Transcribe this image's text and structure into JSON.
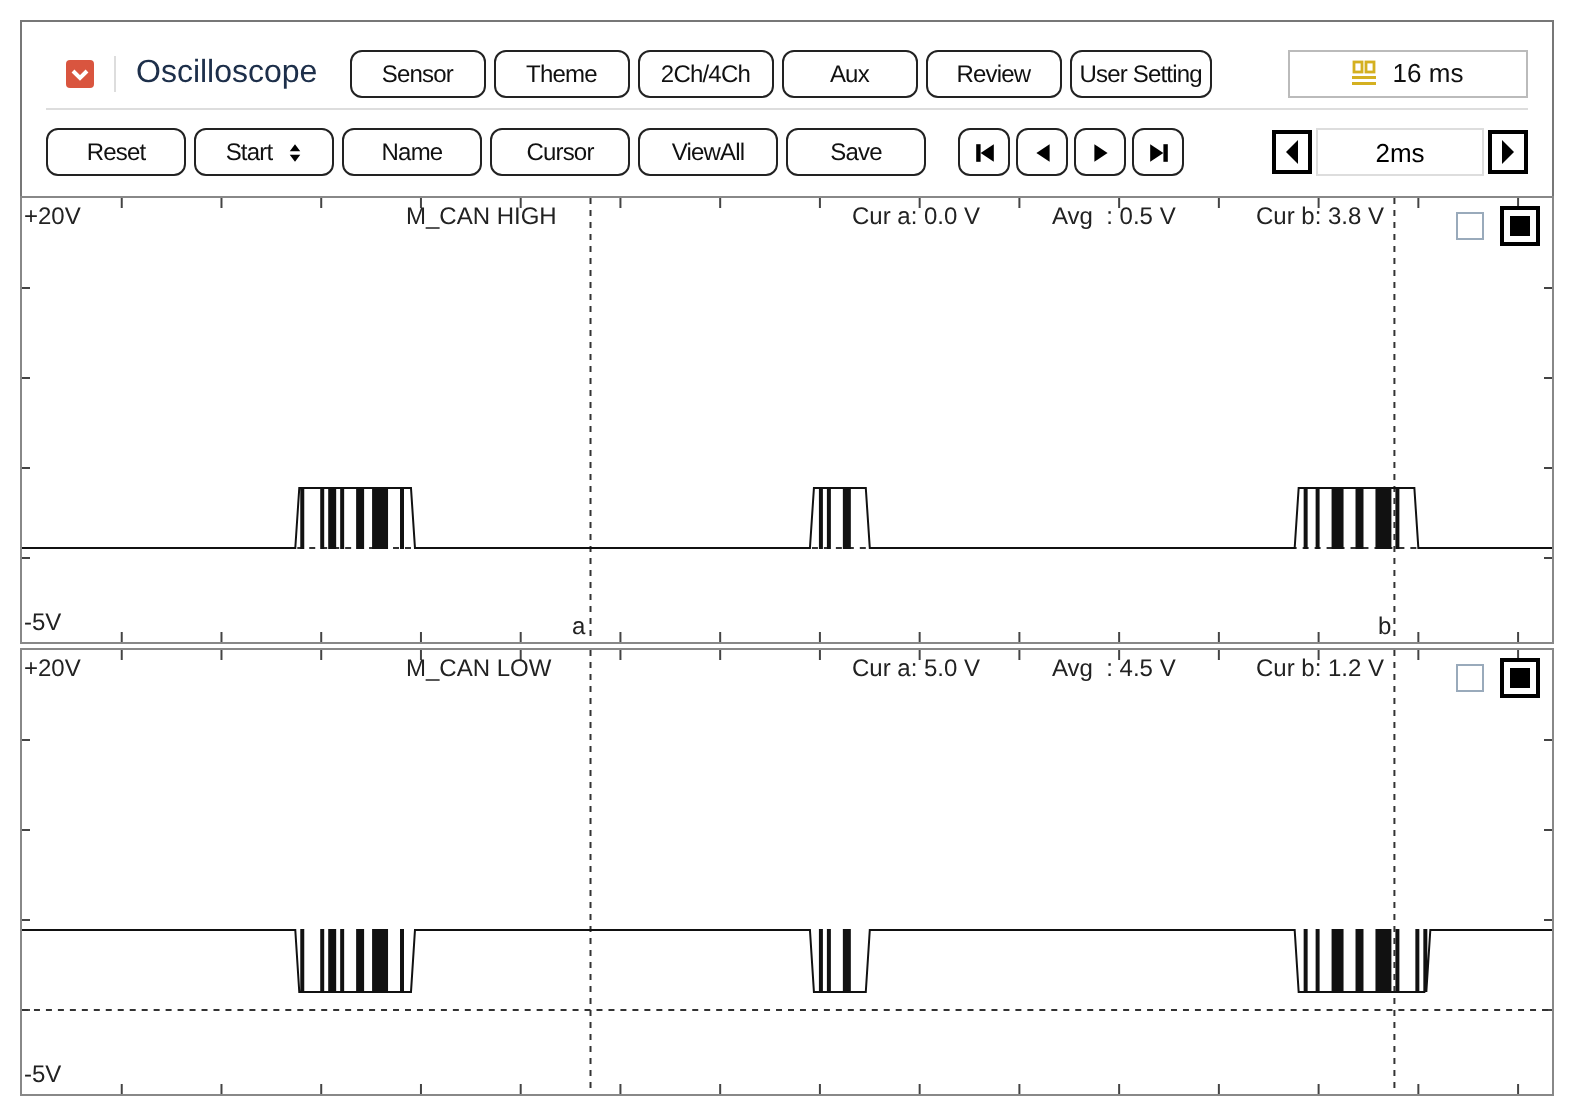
{
  "app": {
    "title": "Oscilloscope"
  },
  "toolbar_top": [
    "Sensor",
    "Theme",
    "2Ch/4Ch",
    "Aux",
    "Review",
    "User Setting"
  ],
  "time_display": "16 ms",
  "toolbar_bottom": [
    {
      "label": "Reset",
      "kind": "button"
    },
    {
      "label": "Start",
      "kind": "spinner"
    },
    {
      "label": "Name",
      "kind": "button"
    },
    {
      "label": "Cursor",
      "kind": "button"
    },
    {
      "label": "ViewAll",
      "kind": "button"
    },
    {
      "label": "Save",
      "kind": "button"
    }
  ],
  "time_scale": {
    "value": "2ms"
  },
  "channels": [
    {
      "name": "M_CAN HIGH",
      "kind": "high",
      "top_label": "+20V",
      "bottom_label": "-5V",
      "cur_a": "Cur a: 0.0 V",
      "avg": "Avg  : 0.5 V",
      "cur_b": "Cur b: 3.8 V",
      "cursor_a_label": "a",
      "cursor_b_label": "b",
      "toggles": [
        {
          "checked": false
        },
        {
          "checked": true
        }
      ]
    },
    {
      "name": "M_CAN LOW",
      "kind": "low",
      "top_label": "+20V",
      "bottom_label": "-5V",
      "cur_a": "Cur a: 5.0 V",
      "avg": "Avg  : 4.5 V",
      "cur_b": "Cur b: 1.2 V",
      "toggles": [
        {
          "checked": false
        },
        {
          "checked": true
        }
      ]
    }
  ]
}
